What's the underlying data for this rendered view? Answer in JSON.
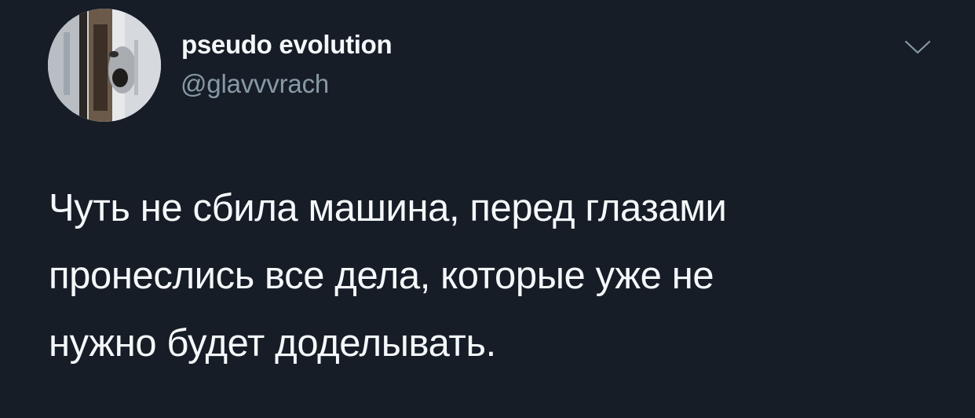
{
  "author": {
    "display_name": "pseudo evolution",
    "handle": "@glavvvrach",
    "avatar_icon": "profile-photo"
  },
  "actions": {
    "more_icon": "chevron-down-icon"
  },
  "tweet": {
    "text": "Чуть не сбила машина, перед глазами\nпронеслись все дела, которые уже не\nнужно будет доделывать."
  },
  "colors": {
    "background": "#161d27",
    "primary_text": "#f5f8fa",
    "secondary_text": "#8899a6"
  }
}
